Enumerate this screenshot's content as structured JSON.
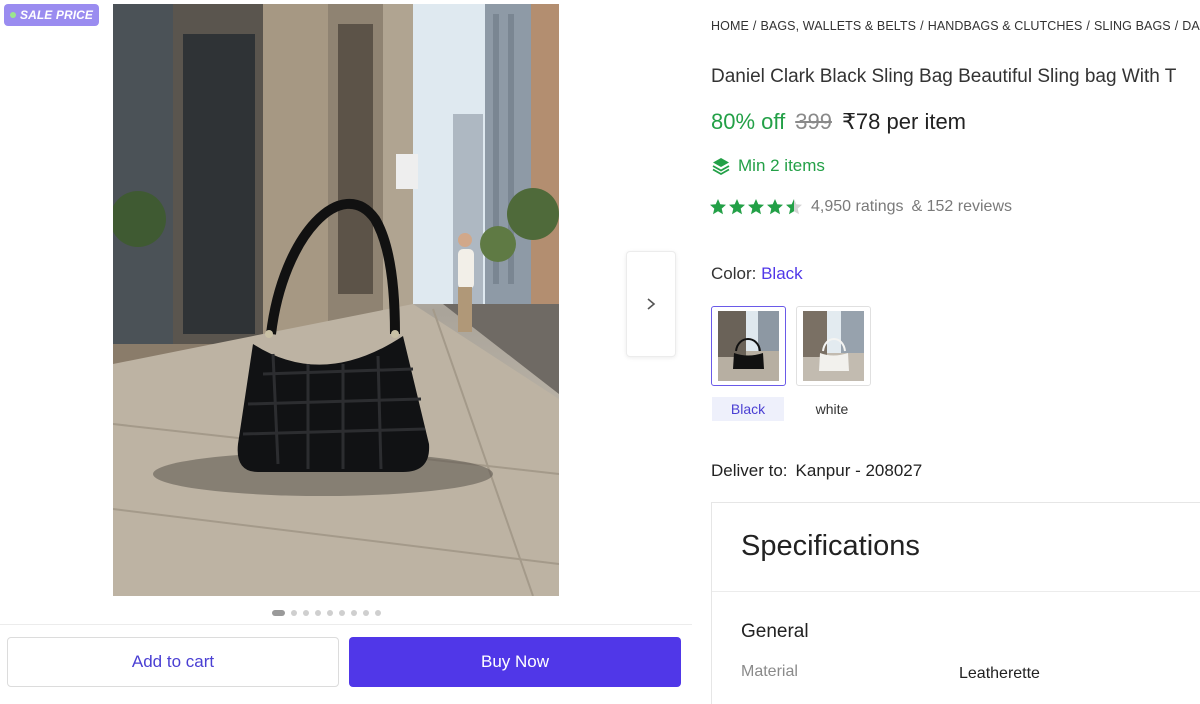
{
  "badge": {
    "sale_label": "SALE PRICE"
  },
  "gallery": {
    "image_count": 9,
    "active_index": 0
  },
  "actions": {
    "add_to_cart": "Add to cart",
    "buy_now": "Buy Now"
  },
  "breadcrumb": [
    "HOME",
    "BAGS, WALLETS & BELTS",
    "HANDBAGS & CLUTCHES",
    "SLING BAGS",
    "DANIEL"
  ],
  "product": {
    "title": "Daniel Clark Black Sling Bag Beautiful Sling bag With T",
    "discount": "80% off",
    "mrp": "399",
    "price": "₹78",
    "price_unit": "per item",
    "min_items": "Min 2 items",
    "rating_value": 4.5,
    "ratings": "4,950 ratings",
    "reviews": "& 152 reviews"
  },
  "color": {
    "label": "Color:",
    "selected": "Black",
    "options": [
      "Black",
      "white"
    ]
  },
  "delivery": {
    "label": "Deliver to:",
    "location": "Kanpur - 208027"
  },
  "specifications": {
    "title": "Specifications",
    "section": "General",
    "rows": [
      {
        "key": "Material",
        "value": "Leatherette"
      }
    ]
  },
  "colors": {
    "accent": "#5037e8",
    "green": "#23a047",
    "badge": "#9a8cf0"
  },
  "icons": {
    "next": "chevron-right-icon",
    "min_items": "layers-icon",
    "rating": "star-icon"
  }
}
